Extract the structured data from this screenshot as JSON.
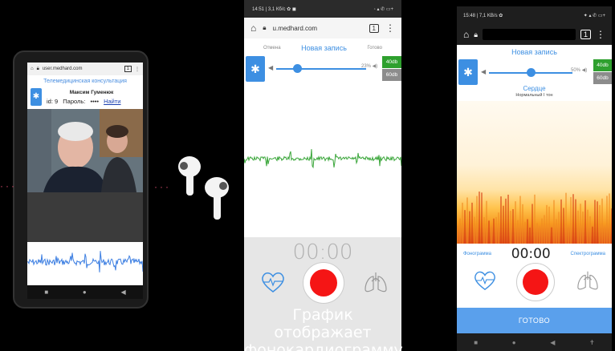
{
  "phone1": {
    "url": "user.medhard.com",
    "tab_count": "1",
    "menu_icon": "⋮",
    "title": "Телемедицинская консультация",
    "doctor_name": "Максим Гуменюк",
    "id_label": "id:",
    "id_value": "9",
    "password_label": "Пароль:",
    "password_value": "••••",
    "login_link": "Найти",
    "nav": [
      "■",
      "●",
      "◀"
    ]
  },
  "phone2": {
    "status_left": "14:51 | 3,1 Кб/с ✿ ◼",
    "status_right": "◦ ▴ ✆ ▭+",
    "url": "u.medhard.com",
    "tab_count": "1",
    "menu_icon": "⋮",
    "tab_left": "Отмена",
    "tab_center": "Новая запись",
    "tab_right": "Готово",
    "volume_pct": "23%",
    "volume_level": 0.23,
    "db_40": "40db",
    "db_60": "60db",
    "timer": "00:00"
  },
  "caption": {
    "line1": "График отображает",
    "line2": "фонокардиограмму"
  },
  "phone3": {
    "status_left": "15:48 | 7,1 KB/s ✿",
    "status_right": "✦ ▴ ✆ ▭+",
    "tab_count": "1",
    "menu_icon": "⋮",
    "title": "Новая запись",
    "volume_pct": "50%",
    "volume_level": 0.5,
    "db_40": "40db",
    "db_60": "60db",
    "organ": "Сердце",
    "tone": "Нормальный I тон",
    "mode_left": "Фонограмма",
    "timer": "00:00",
    "mode_right": "Спектрограмма",
    "done_button": "ГОТОВО",
    "nav": [
      "■",
      "●",
      "◀",
      "✝"
    ]
  },
  "colors": {
    "accent": "#3d8fe2",
    "record": "#f51515",
    "db_active": "#2ea02e",
    "db_inactive": "#8c8c8c",
    "waveform_green": "#3aa63a",
    "waveform_blue": "#3d7fe2"
  }
}
